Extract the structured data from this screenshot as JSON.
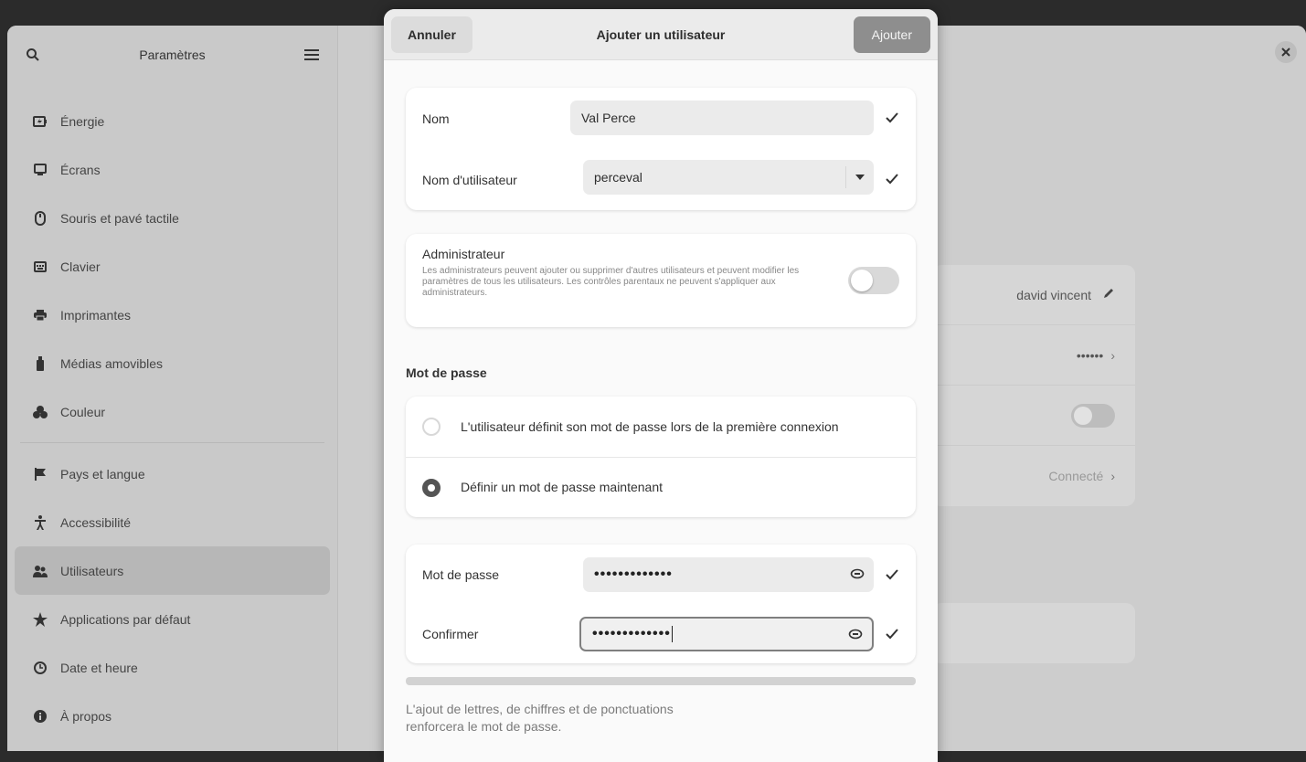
{
  "sidebar": {
    "title": "Paramètres",
    "items": [
      {
        "label": "Énergie",
        "icon": "battery-icon"
      },
      {
        "label": "Écrans",
        "icon": "display-icon"
      },
      {
        "label": "Souris et pavé tactile",
        "icon": "mouse-icon"
      },
      {
        "label": "Clavier",
        "icon": "keyboard-icon"
      },
      {
        "label": "Imprimantes",
        "icon": "printer-icon"
      },
      {
        "label": "Médias amovibles",
        "icon": "usb-icon"
      },
      {
        "label": "Couleur",
        "icon": "palette-icon"
      },
      {
        "label": "Pays et langue",
        "icon": "flag-icon"
      },
      {
        "label": "Accessibilité",
        "icon": "accessibility-icon"
      },
      {
        "label": "Utilisateurs",
        "icon": "users-icon"
      },
      {
        "label": "Applications par défaut",
        "icon": "star-icon"
      },
      {
        "label": "Date et heure",
        "icon": "clock-icon"
      },
      {
        "label": "À propos",
        "icon": "info-icon"
      }
    ],
    "active": "Utilisateurs"
  },
  "background": {
    "user_name": "david vincent",
    "password_mask": "••••••",
    "login_label": "Connecté"
  },
  "dialog": {
    "title": "Ajouter un utilisateur",
    "cancel_label": "Annuler",
    "add_label": "Ajouter",
    "name_label": "Nom",
    "name_value": "Val Perce",
    "username_label": "Nom d'utilisateur",
    "username_value": "perceval",
    "admin_title": "Administrateur",
    "admin_description": "Les administrateurs peuvent ajouter ou supprimer d'autres utilisateurs et peuvent modifier les paramètres de tous les utilisateurs. Les contrôles parentaux ne peuvent s'appliquer aux administrateurs.",
    "admin_enabled": false,
    "password_section": "Mot de passe",
    "radio_option_1": "L'utilisateur définit son mot de passe lors de la première connexion",
    "radio_option_2": "Définir un mot de passe maintenant",
    "selected_option": 2,
    "password_label": "Mot de passe",
    "password_value": "•••••••••••••",
    "confirm_label": "Confirmer",
    "confirm_value": "•••••••••••••",
    "hint": "L'ajout de lettres, de chiffres et de ponctuations renforcera le mot de passe."
  },
  "colors": {
    "dialog_bg": "#fafafa",
    "header_bg": "#ebebeb",
    "add_button_bg": "#8e8e8e",
    "sidebar_active": "#b7b7b7"
  }
}
